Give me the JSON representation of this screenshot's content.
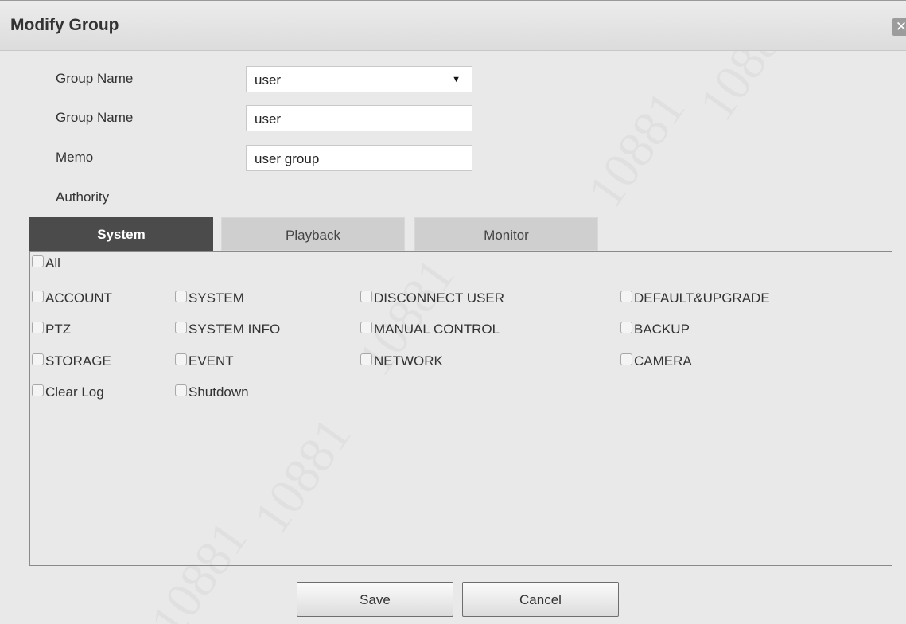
{
  "dialog": {
    "title": "Modify Group",
    "close_glyph": "✕"
  },
  "form": {
    "group_select_label": "Group Name",
    "group_select_value": "user",
    "group_select_arrow": "▼",
    "group_name_label": "Group Name",
    "group_name_value": "user",
    "memo_label": "Memo",
    "memo_value": "user group",
    "authority_label": "Authority"
  },
  "tabs": [
    {
      "label": "System",
      "active": true
    },
    {
      "label": "Playback",
      "active": false
    },
    {
      "label": "Monitor",
      "active": false
    }
  ],
  "permissions": {
    "all": {
      "label": "All",
      "checked": false
    },
    "items": [
      {
        "label": "ACCOUNT",
        "checked": false
      },
      {
        "label": "SYSTEM",
        "checked": false
      },
      {
        "label": "DISCONNECT USER",
        "checked": false
      },
      {
        "label": "DEFAULT&UPGRADE",
        "checked": false
      },
      {
        "label": "PTZ",
        "checked": false
      },
      {
        "label": "SYSTEM INFO",
        "checked": false
      },
      {
        "label": "MANUAL CONTROL",
        "checked": false
      },
      {
        "label": "BACKUP",
        "checked": false
      },
      {
        "label": "STORAGE",
        "checked": false
      },
      {
        "label": "EVENT",
        "checked": false
      },
      {
        "label": "NETWORK",
        "checked": false
      },
      {
        "label": "CAMERA",
        "checked": false
      },
      {
        "label": "Clear Log",
        "checked": false
      },
      {
        "label": "Shutdown",
        "checked": false
      }
    ]
  },
  "buttons": {
    "save": "Save",
    "cancel": "Cancel"
  },
  "watermark": "10881",
  "colors": {
    "active_tab": "#4b4b4b",
    "inactive_tab": "#cfcfcf",
    "background": "#e9e9e9"
  }
}
